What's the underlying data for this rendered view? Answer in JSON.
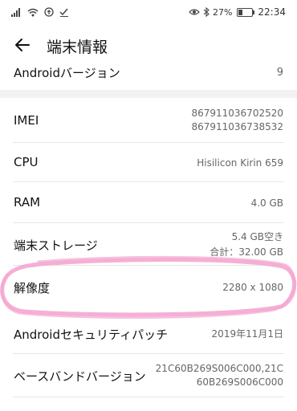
{
  "status": {
    "battery_text": "27%",
    "battery_level": 0.27,
    "time": "22:34",
    "icons_left": [
      "signal-icon",
      "wifi-icon",
      "data-saver-icon",
      "check-icon"
    ],
    "icons_right": [
      "eye-icon",
      "bluetooth-icon",
      "battery-icon"
    ]
  },
  "header": {
    "title": "端末情報",
    "back_icon": "back-arrow-icon"
  },
  "rows": {
    "android_version": {
      "label": "Androidバージョン",
      "value": "9"
    },
    "imei": {
      "label": "IMEI",
      "value_1": "867911036702520",
      "value_2": "867911036738532"
    },
    "cpu": {
      "label": "CPU",
      "value": "Hisilicon Kirin 659"
    },
    "ram": {
      "label": "RAM",
      "value": "4.0 GB"
    },
    "storage": {
      "label": "端末ストレージ",
      "value_1": "5.4  GB空き",
      "value_2": "合計：32.00  GB"
    },
    "resolution": {
      "label": "解像度",
      "value": "2280 x 1080"
    },
    "security_patch": {
      "label": "Androidセキュリティパッチ",
      "value": "2019年11月1日"
    },
    "baseband": {
      "label": "ベースバンドバージョン",
      "value_1": "21C60B269S006C000,21C",
      "value_2": "60B269S006C000"
    }
  },
  "colors": {
    "background": "#ffffff",
    "section_gap": "#f2f2f2",
    "divider": "#e6e6e6",
    "highlight": "#f4a6d0",
    "value_text": "#666666"
  }
}
